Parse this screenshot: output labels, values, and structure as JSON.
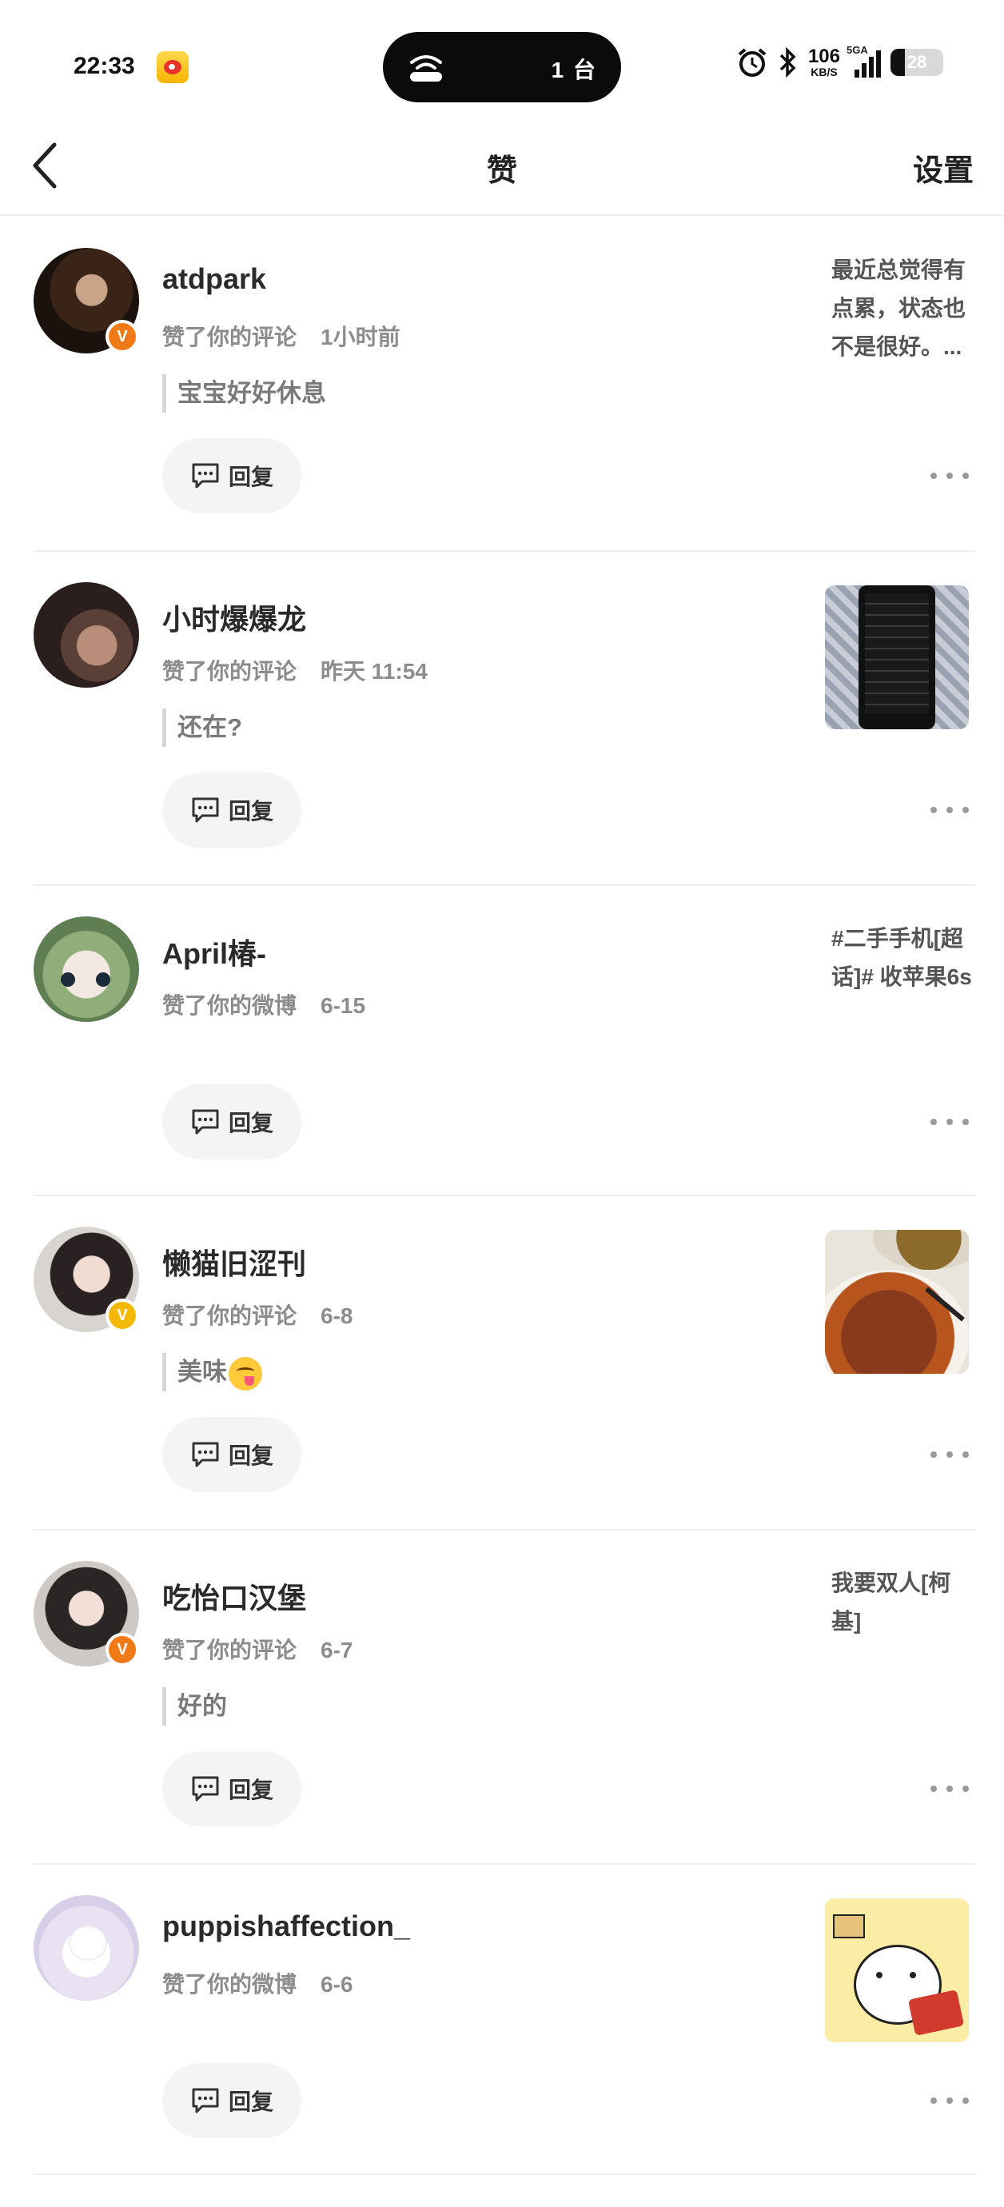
{
  "status_bar": {
    "time": "22:33",
    "island_count": "1 台",
    "net_speed_value": "106",
    "net_speed_unit": "KB/S",
    "network_label": "5GA",
    "battery": "28"
  },
  "nav": {
    "title": "赞",
    "settings_label": "设置"
  },
  "reply_label": "回复",
  "items": [
    {
      "name": "atdpark",
      "action": "赞了你的评论",
      "time": "1小时前",
      "quote": "宝宝好好休息",
      "side_text": "最近总觉得有点累，状态也不是很好。...",
      "badge": "V"
    },
    {
      "name": "小时爆爆龙",
      "action": "赞了你的评论",
      "time": "昨天 11:54",
      "quote": "还在?"
    },
    {
      "name": "April椿-",
      "action": "赞了你的微博",
      "time": "6-15",
      "side_text": "#二手手机[超话]#  收苹果6s"
    },
    {
      "name": "懒猫旧涩刊",
      "action": "赞了你的评论",
      "time": "6-8",
      "quote": "美味",
      "badge": "V"
    },
    {
      "name": "吃怡口汉堡",
      "action": "赞了你的评论",
      "time": "6-7",
      "quote": "好的",
      "side_text": "我要双人[柯基]",
      "badge": "V"
    },
    {
      "name": "puppishaffection_",
      "action": "赞了你的微博",
      "time": "6-6"
    }
  ],
  "colors": {
    "accent_orange": "#f07a18",
    "accent_gold": "#f5b800",
    "divider": "#eeeeee",
    "meta_gray": "#8c8c8c"
  }
}
